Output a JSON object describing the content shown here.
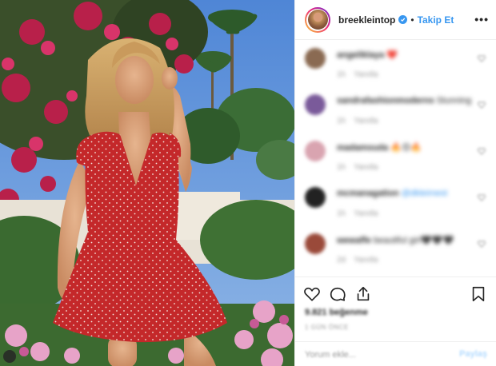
{
  "post": {
    "username": "breekleintop",
    "separator": "•",
    "follow_label": "Takip Et",
    "more_label": "•••"
  },
  "comments": [
    {
      "user": "angeliklaya",
      "text": "❤️",
      "time": "1h",
      "reply": "Yanıtla",
      "avatar_color": "#8a6a52"
    },
    {
      "user": "sandrafashionmoderns",
      "text": "Stunning",
      "time": "1h",
      "reply": "Yanıtla",
      "avatar_color": "#7a5a9a"
    },
    {
      "user": "madamsuda",
      "text": "🔥😍🔥",
      "time": "1h",
      "reply": "Yanıtla",
      "avatar_color": "#d9a4b0"
    },
    {
      "user": "mcmanagation",
      "text": "@dkleimest",
      "time": "1h",
      "reply": "Yanıtla",
      "avatar_color": "#222222"
    },
    {
      "user": "wewaffe",
      "text": "beautiful girl🖤🖤🖤",
      "time": "2d",
      "reply": "Yanıtla",
      "avatar_color": "#9a4a3a"
    }
  ],
  "actions": {
    "likes_text": "9.821 beğenme",
    "timestamp": "1 GÜN ÖNCE",
    "comment_placeholder": "Yorum ekle...",
    "post_label": "Paylaş"
  },
  "icons": [
    "heart-icon",
    "comment-icon",
    "share-icon",
    "bookmark-icon"
  ],
  "colors": {
    "accent": "#3897f0",
    "dress": "#c4282a",
    "sky": "#5b8fd8"
  }
}
